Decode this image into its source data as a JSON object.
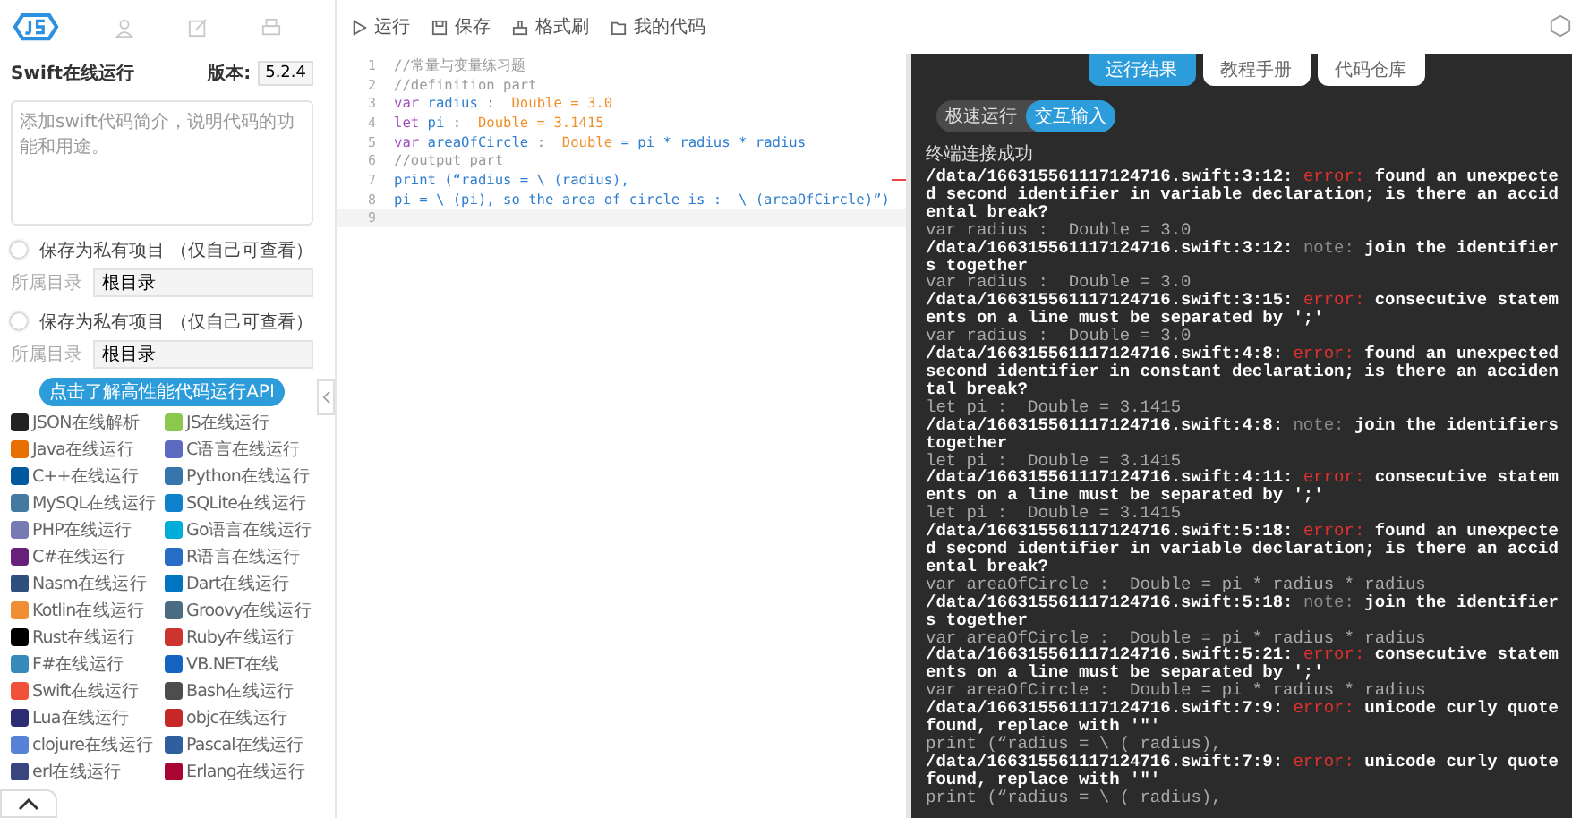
{
  "sidebar": {
    "title": "Swift在线运行",
    "version_label": "版本:",
    "version": "5.2.4",
    "description_placeholder": "添加swift代码简介，说明代码的功能和用途。",
    "options": [
      {
        "toggle_label": "保存为私有项目 （仅自己可查看）",
        "on": false,
        "folder_label": "所属目录",
        "folder": "根目录"
      },
      {
        "toggle_label": "保存为私有项目 （仅自己可查看）",
        "on": false,
        "folder_label": "所属目录",
        "folder": "根目录"
      }
    ],
    "api_button": "点击了解高性能代码运行API",
    "languages": [
      {
        "label": "JSON在线解析",
        "color": "#222222"
      },
      {
        "label": "JS在线运行",
        "color": "#8cc84b"
      },
      {
        "label": "Java在线运行",
        "color": "#e76f00"
      },
      {
        "label": "C语言在线运行",
        "color": "#5c6bc0"
      },
      {
        "label": "C++在线运行",
        "color": "#00599c"
      },
      {
        "label": "Python在线运行",
        "color": "#3776ab"
      },
      {
        "label": "MySQL在线运行",
        "color": "#4479a1"
      },
      {
        "label": "SQLite在线运行",
        "color": "#0f80cc"
      },
      {
        "label": "PHP在线运行",
        "color": "#777bb4"
      },
      {
        "label": "Go语言在线运行",
        "color": "#00add8"
      },
      {
        "label": "C#在线运行",
        "color": "#68217a"
      },
      {
        "label": "R语言在线运行",
        "color": "#276dc3"
      },
      {
        "label": "Nasm在线运行",
        "color": "#2f4f7f"
      },
      {
        "label": "Dart在线运行",
        "color": "#0175c2"
      },
      {
        "label": "Kotlin在线运行",
        "color": "#f18e33"
      },
      {
        "label": "Groovy在线运行",
        "color": "#4a6b82"
      },
      {
        "label": "Rust在线运行",
        "color": "#000000"
      },
      {
        "label": "Ruby在线运行",
        "color": "#cc342d"
      },
      {
        "label": "F#在线运行",
        "color": "#378bba"
      },
      {
        "label": "VB.NET在线",
        "color": "#1565c0"
      },
      {
        "label": "Swift在线运行",
        "color": "#f05138"
      },
      {
        "label": "Bash在线运行",
        "color": "#4d4d4d"
      },
      {
        "label": "Lua在线运行",
        "color": "#2c2d72"
      },
      {
        "label": "objc在线运行",
        "color": "#c62828"
      },
      {
        "label": "clojure在线运行",
        "color": "#5881d8"
      },
      {
        "label": "Pascal在线运行",
        "color": "#2f5f9f"
      },
      {
        "label": "erl在线运行",
        "color": "#39457e"
      },
      {
        "label": "Erlang在线运行",
        "color": "#a90533"
      }
    ]
  },
  "toolbar": [
    {
      "label": "运行",
      "kind": "run"
    },
    {
      "label": "保存",
      "kind": "save"
    },
    {
      "label": "格式刷",
      "kind": "format"
    },
    {
      "label": "我的代码",
      "kind": "folder"
    }
  ],
  "editor": {
    "lines": [
      {
        "number": "1",
        "tokens": [
          {
            "text": "//常量与变量练习题",
            "kind": "comment"
          }
        ]
      },
      {
        "number": "2",
        "tokens": [
          {
            "text": "//definition part",
            "kind": "comment"
          }
        ]
      },
      {
        "number": "3",
        "tokens": [
          {
            "text": "var ",
            "kind": "keyword"
          },
          {
            "text": "radius",
            "kind": "ident"
          },
          {
            "text": " :  ",
            "kind": "plain"
          },
          {
            "text": "Double = 3.0",
            "kind": "type"
          }
        ]
      },
      {
        "number": "4",
        "tokens": [
          {
            "text": "let ",
            "kind": "keyword"
          },
          {
            "text": "pi",
            "kind": "ident"
          },
          {
            "text": " :  ",
            "kind": "plain"
          },
          {
            "text": "Double = 3.1415",
            "kind": "type"
          }
        ]
      },
      {
        "number": "5",
        "tokens": [
          {
            "text": "var ",
            "kind": "keyword"
          },
          {
            "text": "areaOfCircle",
            "kind": "ident"
          },
          {
            "text": " :  ",
            "kind": "plain"
          },
          {
            "text": "Double",
            "kind": "type"
          },
          {
            "text": " = pi * radius * radius",
            "kind": "ident"
          }
        ]
      },
      {
        "number": "6",
        "tokens": [
          {
            "text": "//output part",
            "kind": "comment"
          }
        ]
      },
      {
        "number": "7",
        "tokens": [
          {
            "text": "print (“radius = \\ (radius),",
            "kind": "ident"
          }
        ]
      },
      {
        "number": "8",
        "tokens": [
          {
            "text": "pi = \\ (pi), so the area of circle is :  \\ (areaOfCircle)”)",
            "kind": "ident"
          }
        ]
      },
      {
        "number": "9"
      }
    ]
  },
  "output": {
    "tabs": [
      {
        "label": "运行结果",
        "selected": true
      },
      {
        "label": "教程手册",
        "selected": false
      },
      {
        "label": "代码仓库",
        "selected": false
      }
    ],
    "modes": [
      {
        "label": "极速运行",
        "selected": false
      },
      {
        "label": "交互输入",
        "selected": true
      }
    ],
    "lines": [
      {
        "kind": "info",
        "text": "终端连接成功"
      },
      {
        "kind": "diagnostic",
        "location": "/data/166315561117124716.swift:3:12:",
        "severity": "error:",
        "color": "#e0312e",
        "message": "found an unexpected second identifier in variable declaration; is there an accidental break?"
      },
      {
        "kind": "source",
        "text": "var radius :  Double = 3.0"
      },
      {
        "kind": "diagnostic",
        "location": "/data/166315561117124716.swift:3:12:",
        "severity": "note:",
        "color": "#8a8a8a",
        "message": "join the identifiers together"
      },
      {
        "kind": "source",
        "text": "var radius :  Double = 3.0"
      },
      {
        "kind": "diagnostic",
        "location": "/data/166315561117124716.swift:3:15:",
        "severity": "error:",
        "color": "#e0312e",
        "message": "consecutive statements on a line must be separated by ';'"
      },
      {
        "kind": "source",
        "text": "var radius :  Double = 3.0"
      },
      {
        "kind": "diagnostic",
        "location": "/data/166315561117124716.swift:4:8:",
        "severity": "error:",
        "color": "#e0312e",
        "message": "found an unexpected second identifier in constant declaration; is there an accidental break?"
      },
      {
        "kind": "source",
        "text": "let pi :  Double = 3.1415"
      },
      {
        "kind": "diagnostic",
        "location": "/data/166315561117124716.swift:4:8:",
        "severity": "note:",
        "color": "#8a8a8a",
        "message": "join the identifiers together"
      },
      {
        "kind": "source",
        "text": "let pi :  Double = 3.1415"
      },
      {
        "kind": "diagnostic",
        "location": "/data/166315561117124716.swift:4:11:",
        "severity": "error:",
        "color": "#e0312e",
        "message": "consecutive statements on a line must be separated by ';'"
      },
      {
        "kind": "source",
        "text": "let pi :  Double = 3.1415"
      },
      {
        "kind": "diagnostic",
        "location": "/data/166315561117124716.swift:5:18:",
        "severity": "error:",
        "color": "#e0312e",
        "message": "found an unexpected second identifier in variable declaration; is there an accidental break?"
      },
      {
        "kind": "source",
        "text": "var areaOfCircle :  Double = pi * radius * radius"
      },
      {
        "kind": "diagnostic",
        "location": "/data/166315561117124716.swift:5:18:",
        "severity": "note:",
        "color": "#8a8a8a",
        "message": "join the identifiers together"
      },
      {
        "kind": "source",
        "text": "var areaOfCircle :  Double = pi * radius * radius"
      },
      {
        "kind": "diagnostic",
        "location": "/data/166315561117124716.swift:5:21:",
        "severity": "error:",
        "color": "#e0312e",
        "message": "consecutive statements on a line must be separated by ';'"
      },
      {
        "kind": "source",
        "text": "var areaOfCircle :  Double = pi * radius * radius"
      },
      {
        "kind": "diagnostic",
        "location": "/data/166315561117124716.swift:7:9:",
        "severity": "error:",
        "color": "#e0312e",
        "message": "unicode curly quote found, replace with '\"'"
      },
      {
        "kind": "source",
        "text": "print (“radius = \\ ( radius),"
      },
      {
        "kind": "diagnostic",
        "location": "/data/166315561117124716.swift:7:9:",
        "severity": "error:",
        "color": "#e0312e",
        "message": "unicode curly quote found, replace with '\"'"
      },
      {
        "kind": "source",
        "text": "print (“radius = \\ ( radius),"
      }
    ]
  }
}
